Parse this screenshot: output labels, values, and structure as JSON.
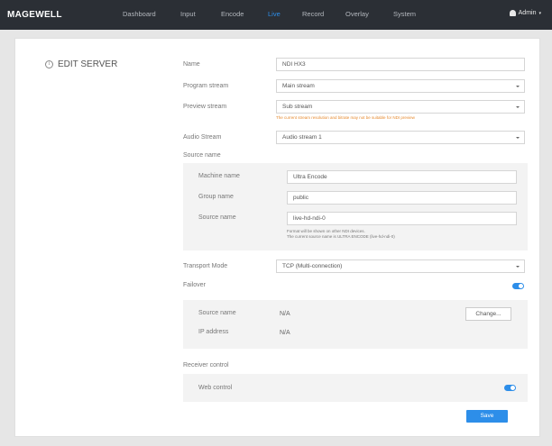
{
  "header": {
    "logo": "MAGEWELL",
    "nav": [
      "Dashboard",
      "Input",
      "Encode",
      "Live",
      "Record",
      "Overlay",
      "System"
    ],
    "active_nav": "Live",
    "user": "Admin"
  },
  "page": {
    "title": "EDIT SERVER"
  },
  "form": {
    "name": {
      "label": "Name",
      "value": "NDI HX3"
    },
    "program_stream": {
      "label": "Program stream",
      "value": "Main stream"
    },
    "preview_stream": {
      "label": "Preview stream",
      "value": "Sub stream"
    },
    "preview_warning": "The current stream resolution and bitrate may not be suitable for NDI preview",
    "audio_stream": {
      "label": "Audio Stream",
      "value": "Audio stream 1"
    },
    "source_name_section": "Source name",
    "machine_name": {
      "label": "Machine name",
      "value": "Ultra Encode"
    },
    "group_name": {
      "label": "Group name",
      "value": "public"
    },
    "source_name": {
      "label": "Source name",
      "value": "live-hd-ndi-0"
    },
    "source_hint_1": "Format will be shown on other NDI devices.",
    "source_hint_2": "The current source name is ULTRA ENCODE (live-hd-ndi-0)",
    "transport_mode": {
      "label": "Transport Mode",
      "value": "TCP (Multi-connection)"
    },
    "failover": {
      "label": "Failover",
      "enabled": true
    },
    "failover_source_name": {
      "label": "Source name",
      "value": "N/A"
    },
    "change_button": "Change...",
    "ip_address": {
      "label": "IP address",
      "value": "N/A"
    },
    "receiver_control_section": "Receiver control",
    "web_control": {
      "label": "Web control",
      "enabled": true
    },
    "save_button": "Save"
  },
  "colors": {
    "accent": "#2d8ee9",
    "topbar": "#2b2f35",
    "warning": "#e6892e"
  }
}
